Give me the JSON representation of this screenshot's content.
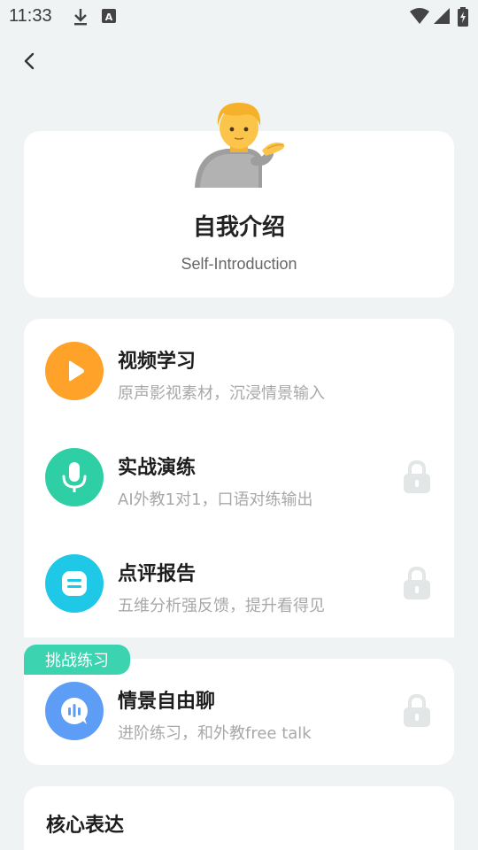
{
  "status_bar": {
    "time": "11:33",
    "icons": [
      "download-icon",
      "keyboard-a-icon",
      "wifi-icon",
      "signal-icon",
      "battery-charging-icon"
    ]
  },
  "nav": {
    "back_icon": "chevron-left-icon"
  },
  "hero": {
    "emoji": "person-tipping-hand-emoji",
    "title": "自我介绍",
    "subtitle": "Self-Introduction"
  },
  "steps": [
    {
      "title": "视频学习",
      "desc": "原声影视素材，沉浸情景输入",
      "icon": "play-icon",
      "color": "#ffa229",
      "locked": false
    },
    {
      "title": "实战演练",
      "desc": "AI外教1对1，口语对练输出",
      "icon": "microphone-icon",
      "color": "#2fcfa6",
      "locked": true
    },
    {
      "title": "点评报告",
      "desc": "五维分析强反馈，提升看得见",
      "icon": "report-icon",
      "color": "#1fc8e6",
      "locked": true
    }
  ],
  "challenge": {
    "tag": "挑战练习",
    "title": "情景自由聊",
    "desc": "进阶练习，和外教free talk",
    "icon": "chat-bubble-icon",
    "color": "#5d9df5",
    "locked": true
  },
  "core": {
    "title": "核心表达"
  }
}
